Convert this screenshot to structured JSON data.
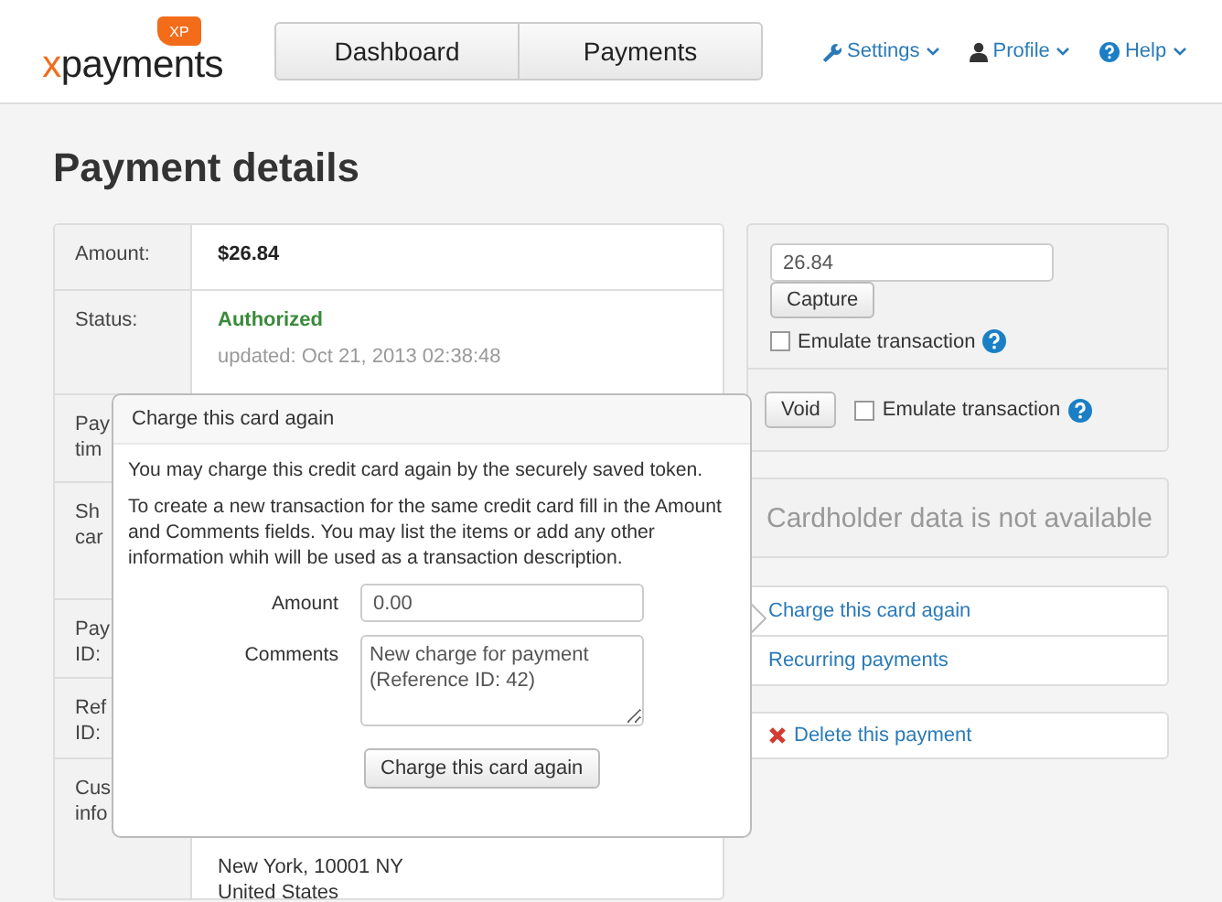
{
  "header": {
    "logo": {
      "mark": "x",
      "text": "payments",
      "tag": "XP"
    },
    "nav": [
      {
        "label": "Dashboard",
        "selected": false
      },
      {
        "label": "Payments",
        "selected": false
      }
    ],
    "menus": [
      {
        "label": "Settings",
        "kind": "wrench"
      },
      {
        "label": "Profile",
        "kind": "user"
      },
      {
        "label": "Help",
        "kind": "help"
      }
    ]
  },
  "page_title": "Payment details",
  "details": [
    {
      "kind": "amount",
      "label": [
        "Amount:"
      ],
      "value": [
        "$26.84"
      ]
    },
    {
      "kind": "status",
      "label": [
        "Status:"
      ],
      "value": [
        "Authorized",
        "updated: Oct 21, 2013 02:38:48"
      ]
    },
    {
      "kind": "plain",
      "label": [
        "Pay",
        "tim"
      ]
    },
    {
      "kind": "plain",
      "label": [
        "Sh",
        "car"
      ]
    },
    {
      "kind": "plain",
      "label": [
        "Pay",
        "ID:"
      ]
    },
    {
      "kind": "plain",
      "label": [
        "Ref",
        "ID:"
      ]
    },
    {
      "kind": "address",
      "label": [
        "Cus",
        "info"
      ],
      "value": [
        "New York, 10001 NY",
        "United States"
      ]
    }
  ],
  "capture": {
    "amount": "26.84",
    "button": "Capture",
    "emulate": {
      "label": "Emulate transaction",
      "checked": false
    }
  },
  "void": {
    "button": "Void",
    "emulate": {
      "label": "Emulate transaction",
      "checked": false
    }
  },
  "cardholder_note": "Cardholder data is not available",
  "links": [
    {
      "label": "Charge this card again"
    },
    {
      "label": "Recurring payments"
    }
  ],
  "delete_link": "Delete this payment",
  "popover": {
    "title": "Charge this card again",
    "paragraphs": [
      "You may charge this credit card again by the securely saved token.",
      "To create a new transaction for the same credit card fill in the Amount and Comments fields. You may list the items or add any other information whih will be used as a transaction description."
    ],
    "amount_label": "Amount",
    "amount": "0.00",
    "comments_label": "Comments",
    "comments": "New charge for payment\n(Reference ID: 42)",
    "button": "Charge this card again"
  }
}
